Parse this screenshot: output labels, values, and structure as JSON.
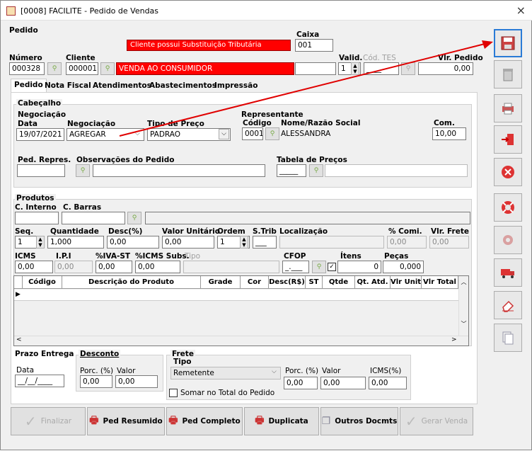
{
  "window": {
    "title": "[0008] FACILITE - Pedido de Vendas",
    "close": "×"
  },
  "header": {
    "pedido_label": "Pedido",
    "alert": "Cliente possui Substituição Tributária",
    "caixa_label": "Caixa",
    "caixa_value": "001",
    "numero_label": "Número",
    "numero_value": "000328",
    "cliente_label": "Cliente",
    "cliente_code": "000001",
    "cliente_name": "VENDA AO CONSUMIDOR",
    "valid_label": "Valid.",
    "valid_value": "1",
    "cod_tes_label": "Cód. TES",
    "cod_tes_value": "____",
    "vlr_pedido_label": "Vlr. Pedido",
    "vlr_pedido_value": "0,00"
  },
  "tabs": [
    "Pedido",
    "Nota Fiscal",
    "Atendimentos",
    "Abastecimentos",
    "Impressão"
  ],
  "cabecalho": {
    "title": "Cabeçalho",
    "negociacao_group": "Negociação",
    "data_label": "Data",
    "data_value": "19/07/2021",
    "negociacao_label": "Negociação",
    "negociacao_value": "AGREGAR",
    "tipo_preco_label": "Tipo de Preço",
    "tipo_preco_value": "PADRAO",
    "representante_group": "Representante",
    "codigo_label": "Código",
    "codigo_value": "0001",
    "nome_label": "Nome/Razão Social",
    "nome_value": "ALESSANDRA",
    "com_label": "Com.",
    "com_value": "10,00",
    "ped_repres_label": "Ped. Repres.",
    "obs_label": "Observações do Pedido",
    "tabela_precos_label": "Tabela de Preços",
    "tabela_value": "_____"
  },
  "produtos": {
    "title": "Produtos",
    "c_interno_label": "C. Interno",
    "c_barras_label": "C. Barras",
    "seq_label": "Seq.",
    "seq_value": "1",
    "quantidade_label": "Quantidade",
    "quantidade_value": "1,000",
    "desc_label": "Desc(%)",
    "desc_value": "0,00",
    "valor_unitario_label": "Valor Unitário",
    "valor_unitario_value": "0,00",
    "ordem_label": "Ordem",
    "ordem_value": "1",
    "strib_label": "S.Trib",
    "strib_value": "___",
    "localizacao_label": "Localização",
    "comi_label": "% Comi.",
    "comi_value": "0,00",
    "vlr_frete_label": "Vlr. Frete",
    "vlr_frete_value": "0,00",
    "icms_label": "ICMS",
    "icms_value": "0,00",
    "ipi_label": "I.P.I",
    "ipi_value": "0,00",
    "iva_label": "%IVA-ST",
    "iva_value": "0,00",
    "icms_subs_label": "%ICMS Subs.",
    "icms_subs_value": "0,00",
    "tipo_label": "Tipo",
    "cfop_label": "CFOP",
    "cfop_value": "_.___",
    "itens_label": "Ítens",
    "itens_value": "0",
    "pecas_label": "Peças",
    "pecas_value": "0,000"
  },
  "grid": {
    "columns": [
      "Código",
      "Descrição do Produto",
      "Grade",
      "Cor",
      "Desc(R$)",
      "ST",
      "Qtde",
      "Qt. Atd.",
      "Vlr Unit",
      "Vlr Total"
    ]
  },
  "footer": {
    "prazo_label": "Prazo Entrega",
    "prazo_data_label": "Data",
    "prazo_data_value": "__/__/____",
    "desconto_label": "Desconto",
    "porc_label": "Porc. (%)",
    "valor_label": "Valor",
    "desc_porc_value": "0,00",
    "desc_valor_value": "0,00",
    "frete_label": "Frete",
    "frete_tipo_label": "Tipo",
    "frete_tipo_value": "Remetente",
    "frete_porc_label": "Porc. (%)",
    "frete_valor_label": "Valor",
    "frete_icms_label": "ICMS(%)",
    "frete_porc_value": "0,00",
    "frete_valor_value": "0,00",
    "frete_icms_value": "0,00",
    "somar_label": "Somar no Total do Pedido"
  },
  "bottom_buttons": [
    "Finalizar",
    "Ped Resumido",
    "Ped Completo",
    "Duplicata",
    "Outros Docmts",
    "Gerar Venda"
  ],
  "colors": {
    "alert_red": "#ff0000",
    "arrow_red": "#e00000"
  }
}
